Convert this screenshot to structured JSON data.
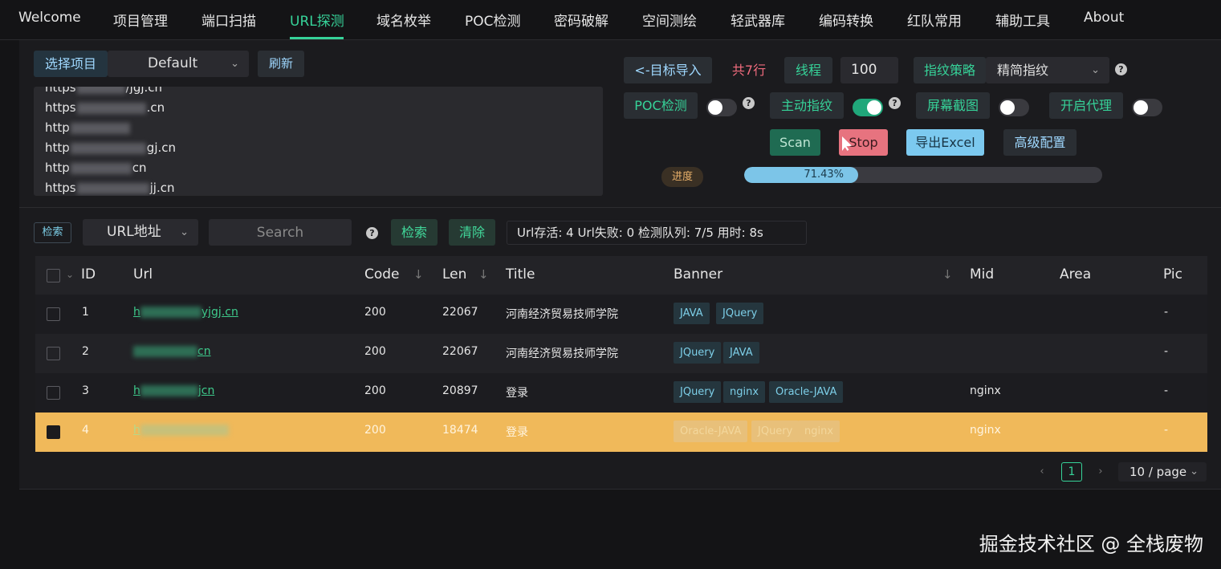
{
  "nav": {
    "items": [
      "Welcome",
      "项目管理",
      "端口扫描",
      "URL探测",
      "域名枚举",
      "POC检测",
      "密码破解",
      "空间测绘",
      "轻武器库",
      "编码转换",
      "红队常用",
      "辅助工具",
      "About"
    ],
    "active": "URL探测"
  },
  "project": {
    "select_label": "选择项目",
    "selected": "Default",
    "refresh_label": "刷新"
  },
  "targets": {
    "lines": [
      "https://jgj.cn",
      "https:.cn",
      "http",
      "http:gj.cn",
      "http:cn",
      "https:jj.cn"
    ]
  },
  "controls": {
    "import_label": "<-目标导入",
    "rows_count": "共7行",
    "threads_label": "线程",
    "threads_value": "100",
    "fingerprint_strategy_label": "指纹策略",
    "fingerprint_strategy_value": "精简指纹",
    "poc_label": "POC检测",
    "poc_on": false,
    "active_fp_label": "主动指纹",
    "active_fp_on": true,
    "screenshot_label": "屏幕截图",
    "screenshot_on": false,
    "proxy_label": "开启代理",
    "proxy_on": false,
    "scan_label": "Scan",
    "stop_label": "Stop",
    "export_label": "导出Excel",
    "advanced_label": "高级配置",
    "progress_label": "进度",
    "progress_text": "71.43%",
    "progress_value": 71.43
  },
  "search": {
    "scope_label": "检索",
    "field_selected": "URL地址",
    "placeholder": "Search",
    "search_label": "检索",
    "clear_label": "清除",
    "stats": "Url存活: 4   Url失败: 0   检测队列: 7/5   用时: 8s"
  },
  "table": {
    "columns": [
      "ID",
      "Url",
      "Code",
      "Len",
      "Title",
      "Banner",
      "Mid",
      "Area",
      "Pic"
    ],
    "rows": [
      {
        "id": "1",
        "url": "yjgj.cn",
        "code": "200",
        "len": "22067",
        "title": "河南经济贸易技师学院",
        "banner": [
          "JAVA",
          "JQuery"
        ],
        "mid": "",
        "area": "",
        "pic": "-"
      },
      {
        "id": "2",
        "url": "cn",
        "code": "200",
        "len": "22067",
        "title": "河南经济贸易技师学院",
        "banner": [
          "JQuery",
          "JAVA"
        ],
        "mid": "",
        "area": "",
        "pic": "-"
      },
      {
        "id": "3",
        "url": "jcn",
        "code": "200",
        "len": "20897",
        "title": "登录",
        "banner": [
          "JQuery",
          "nginx",
          "Oracle-JAVA"
        ],
        "mid": "nginx",
        "area": "",
        "pic": "-"
      },
      {
        "id": "4",
        "url": "",
        "code": "200",
        "len": "18474",
        "title": "登录",
        "banner": [
          "Oracle-JAVA",
          "JQuery",
          "nginx"
        ],
        "mid": "nginx",
        "area": "",
        "pic": "-"
      }
    ]
  },
  "pagination": {
    "page": "1",
    "page_size": "10 / page"
  },
  "watermark": "掘金技术社区 @ 全栈废物"
}
